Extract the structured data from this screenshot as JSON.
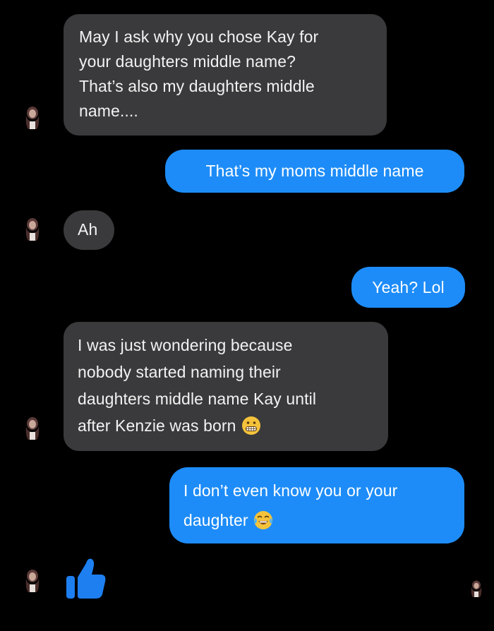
{
  "messages": [
    {
      "sender": "contact",
      "lines": [
        "May I ask why you chose Kay for",
        "your daughters middle name?",
        "That’s also my daughters middle",
        "name...."
      ]
    },
    {
      "sender": "me",
      "lines": [
        "That’s my moms middle name"
      ]
    },
    {
      "sender": "contact",
      "lines": [
        "Ah"
      ]
    },
    {
      "sender": "me",
      "lines": [
        "Yeah? Lol"
      ]
    },
    {
      "sender": "contact",
      "lines": [
        "I was just wondering because",
        "nobody started naming their",
        "daughters middle name Kay until",
        "after Kenzie was born"
      ],
      "emoji": "grimacing-face-icon"
    },
    {
      "sender": "me",
      "lines": [
        "I don’t even know you or your",
        "daughter"
      ],
      "emoji": "tears-of-joy-face-icon"
    },
    {
      "sender": "contact",
      "type": "reaction",
      "icon": "thumbs-up-icon"
    }
  ],
  "colors": {
    "background": "#000000",
    "incoming_bubble": "#3a3a3c",
    "outgoing_bubble": "#1d8cf8",
    "thumbs_up": "#1d7ff0"
  }
}
